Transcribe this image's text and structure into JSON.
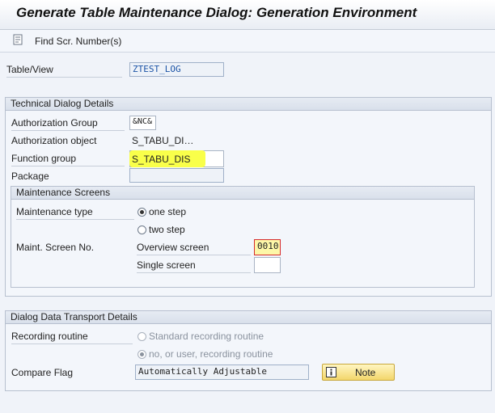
{
  "window": {
    "title": "Generate Table Maintenance Dialog: Generation Environment"
  },
  "toolbar": {
    "find_label": "Find Scr. Number(s)",
    "find_icon": "document-icon"
  },
  "main": {
    "table_view_label": "Table/View",
    "table_view_value": "ZTEST_LOG"
  },
  "technical": {
    "header": "Technical Dialog Details",
    "auth_group_label": "Authorization Group",
    "auth_group_value": "&NC&",
    "auth_object_label": "Authorization object",
    "auth_object_value": "S_TABU_DI…",
    "function_group_label": "Function group",
    "function_group_value": "S_TABU_DIS",
    "package_label": "Package",
    "package_value": ""
  },
  "maintenance": {
    "header": "Maintenance Screens",
    "type_label": "Maintenance type",
    "one_step_label": "one step",
    "two_step_label": "two step",
    "screen_no_label": "Maint. Screen No.",
    "overview_label": "Overview screen",
    "overview_value": "0010",
    "single_label": "Single screen",
    "single_value": ""
  },
  "transport": {
    "header": "Dialog Data Transport Details",
    "recording_label": "Recording routine",
    "standard_label": "Standard recording routine",
    "no_user_label": "no, or user, recording routine",
    "compare_label": "Compare Flag",
    "compare_value": "Automatically Adjustable",
    "note_label": "Note",
    "note_icon": "info-icon"
  },
  "colors": {
    "highlight": "#f9ff4a",
    "link": "#1b53a6"
  }
}
